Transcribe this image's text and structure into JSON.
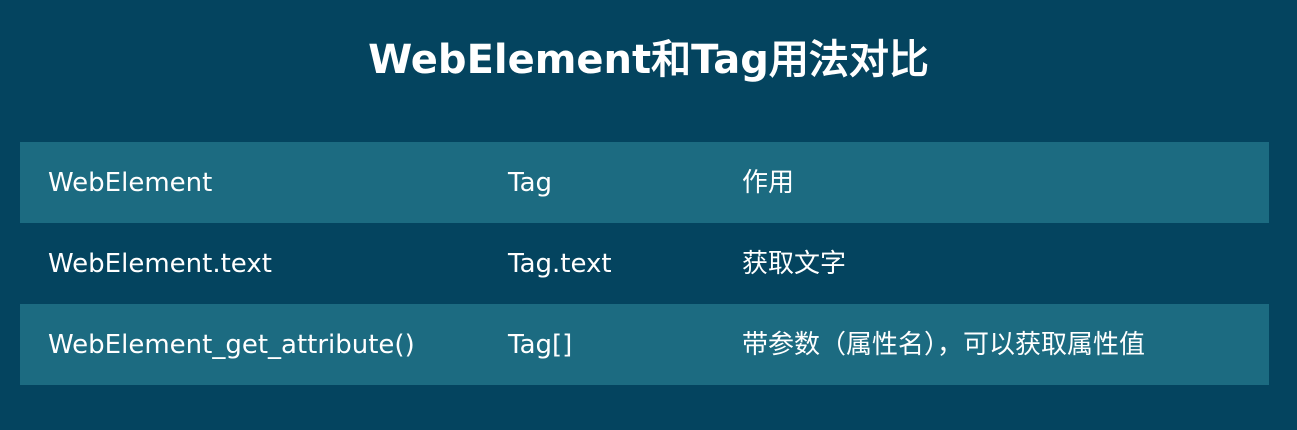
{
  "title": "WebElement和Tag用法对比",
  "table": {
    "rows": [
      [
        "WebElement",
        "Tag",
        "作用"
      ],
      [
        "WebElement.text",
        "Tag.text",
        "获取文字"
      ],
      [
        "WebElement_get_attribute()",
        "Tag[]",
        "带参数（属性名），可以获取属性值"
      ]
    ]
  },
  "colors": {
    "background": "#04445f",
    "shaded_row": "#1c6b81",
    "text": "#ffffff"
  }
}
